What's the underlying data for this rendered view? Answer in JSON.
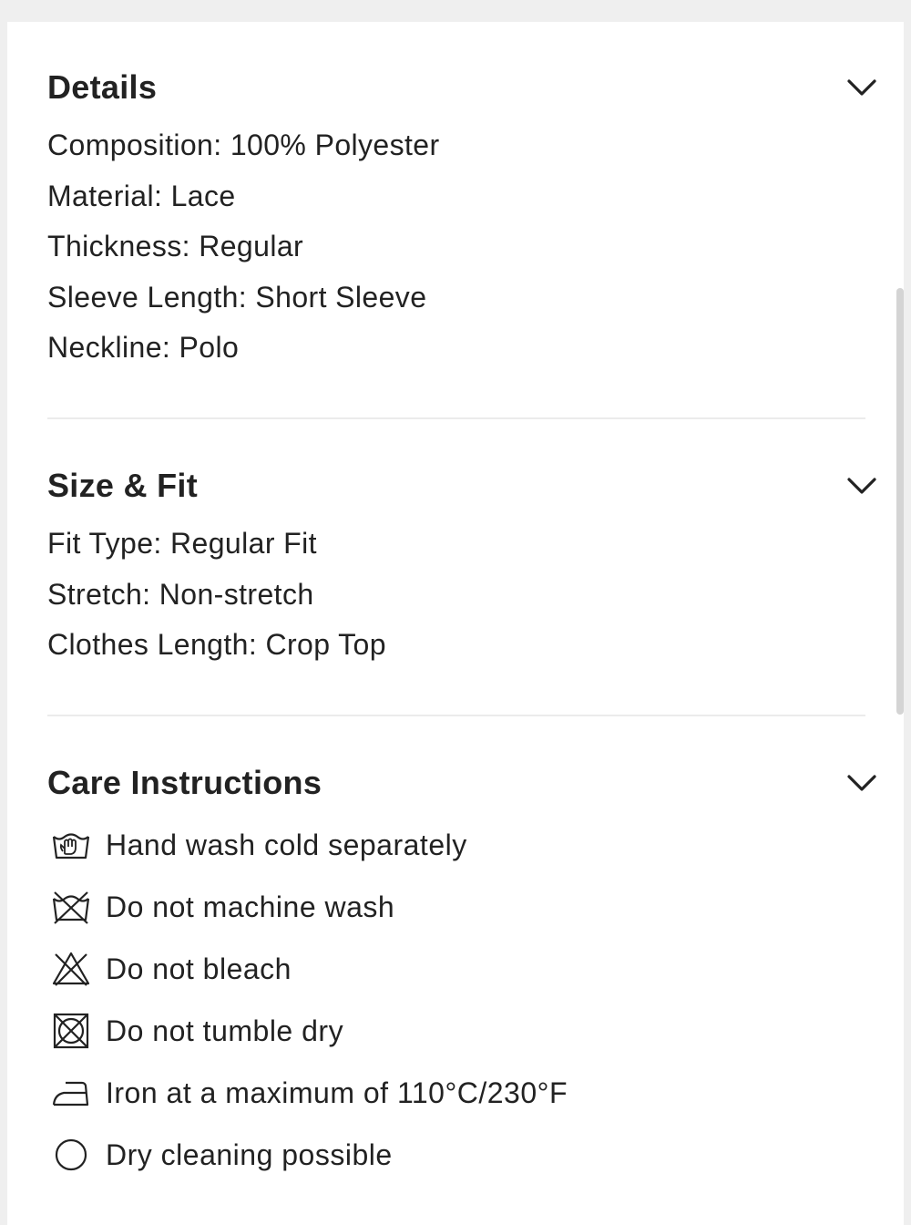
{
  "sections": {
    "details": {
      "title": "Details",
      "lines": [
        "Composition: 100% Polyester",
        "Material: Lace",
        "Thickness: Regular",
        "Sleeve Length: Short Sleeve",
        "Neckline: Polo"
      ]
    },
    "size_fit": {
      "title": "Size & Fit",
      "lines": [
        "Fit Type: Regular Fit",
        "Stretch: Non-stretch",
        "Clothes Length: Crop Top"
      ]
    },
    "care": {
      "title": "Care Instructions",
      "items": [
        {
          "icon": "hand-wash-icon",
          "text": "Hand wash cold separately"
        },
        {
          "icon": "no-machine-wash-icon",
          "text": "Do not machine wash"
        },
        {
          "icon": "no-bleach-icon",
          "text": "Do not bleach"
        },
        {
          "icon": "no-tumble-dry-icon",
          "text": "Do not tumble dry"
        },
        {
          "icon": "iron-icon",
          "text": "Iron at a maximum of 110°C/230°F"
        },
        {
          "icon": "dry-clean-icon",
          "text": "Dry cleaning possible"
        }
      ]
    }
  },
  "colors": {
    "text": "#222222",
    "divider": "#ebebeb",
    "page_background": "#efefef",
    "panel_background": "#ffffff",
    "scrollbar": "#d4d4d4"
  },
  "icons": {
    "expand": "chevron-down-icon"
  }
}
